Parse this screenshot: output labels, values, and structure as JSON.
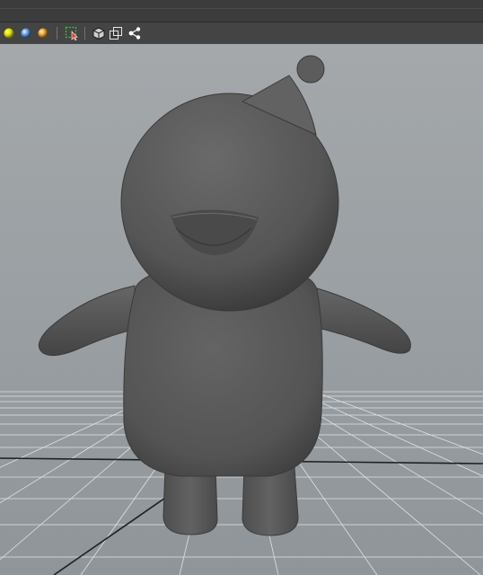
{
  "app": {
    "name": "3D viewport"
  },
  "toolbar": {
    "buttons": [
      {
        "name": "light-yellow-icon",
        "color": "#d8d800"
      },
      {
        "name": "light-blue-icon",
        "color": "#5f98d8"
      },
      {
        "name": "light-orange-icon",
        "color": "#e0a030"
      },
      {
        "name": "select-tool-icon",
        "color": "#3fbf3f"
      },
      {
        "name": "cube-icon"
      },
      {
        "name": "duplicate-icon"
      },
      {
        "name": "share-icon"
      }
    ]
  },
  "viewport": {
    "model": "cartoon-character",
    "colors": {
      "background": "#999fa2",
      "grid": "#ffffff",
      "model": "#5a5a5a"
    }
  }
}
